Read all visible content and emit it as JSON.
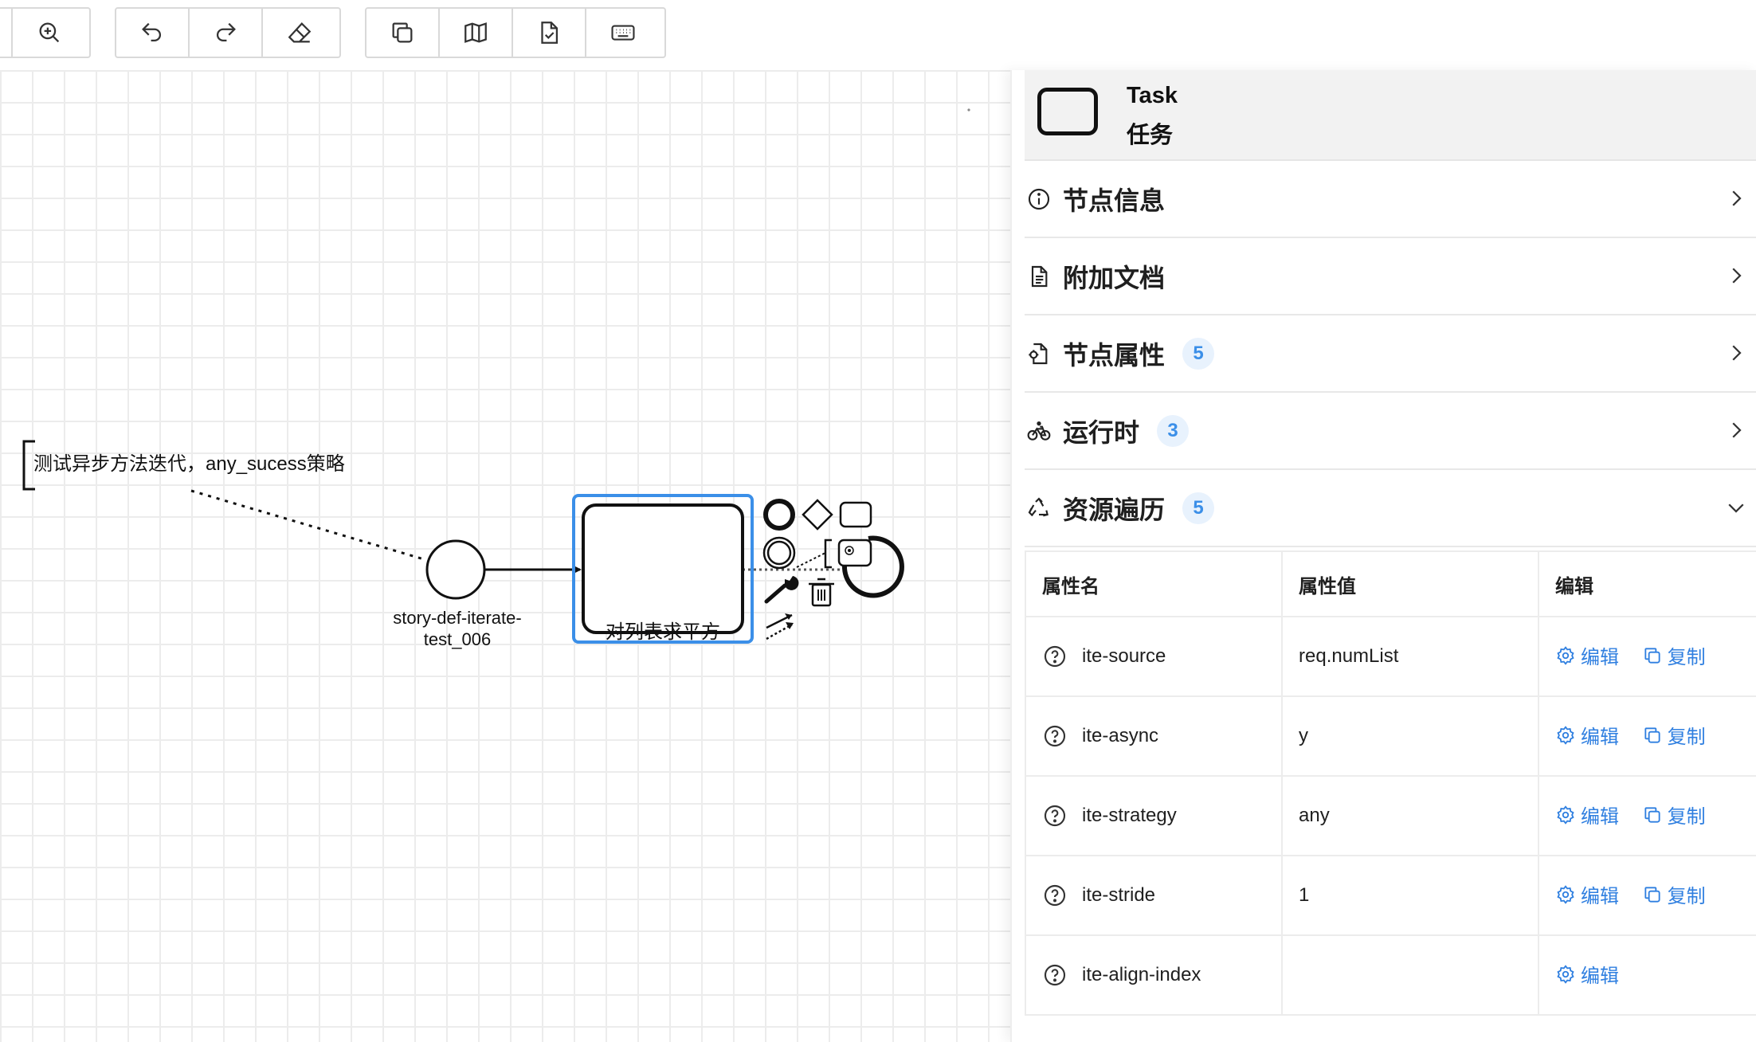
{
  "toolbar": {
    "buttons": [
      {
        "icon": "zoom-in-icon"
      },
      {
        "icon": "undo-icon"
      },
      {
        "icon": "redo-icon"
      },
      {
        "icon": "eraser-icon"
      },
      {
        "icon": "copy-icon"
      },
      {
        "icon": "map-icon"
      },
      {
        "icon": "document-check-icon"
      },
      {
        "icon": "keyboard-icon"
      }
    ]
  },
  "canvas": {
    "annotation": "测试异步方法迭代，any_sucess策略",
    "start_event_label": "story-def-iterate-test_006",
    "task_label": "对列表求平方"
  },
  "panel": {
    "header": {
      "title": "Task",
      "subtitle": "任务"
    },
    "sections": [
      {
        "title": "节点信息",
        "icon": "info-icon",
        "expanded": false
      },
      {
        "title": "附加文档",
        "icon": "document-icon",
        "expanded": false
      },
      {
        "title": "节点属性",
        "icon": "file-gear-icon",
        "badge": "5",
        "expanded": false
      },
      {
        "title": "运行时",
        "icon": "bike-icon",
        "badge": "3",
        "expanded": false
      },
      {
        "title": "资源遍历",
        "icon": "recycle-icon",
        "badge": "5",
        "expanded": true
      }
    ],
    "table": {
      "headers": [
        "属性名",
        "属性值",
        "编辑"
      ],
      "rows": [
        {
          "name": "ite-source",
          "value": "req.numList",
          "edit": "编辑",
          "copy": "复制"
        },
        {
          "name": "ite-async",
          "value": "y",
          "edit": "编辑",
          "copy": "复制"
        },
        {
          "name": "ite-strategy",
          "value": "any",
          "edit": "编辑",
          "copy": "复制"
        },
        {
          "name": "ite-stride",
          "value": "1",
          "edit": "编辑",
          "copy": "复制"
        },
        {
          "name": "ite-align-index",
          "value": "",
          "edit": "编辑"
        }
      ]
    }
  },
  "colors": {
    "accent": "#2f7fe0",
    "badge_bg": "#e8f2fd",
    "selection": "#3b8fe8"
  }
}
